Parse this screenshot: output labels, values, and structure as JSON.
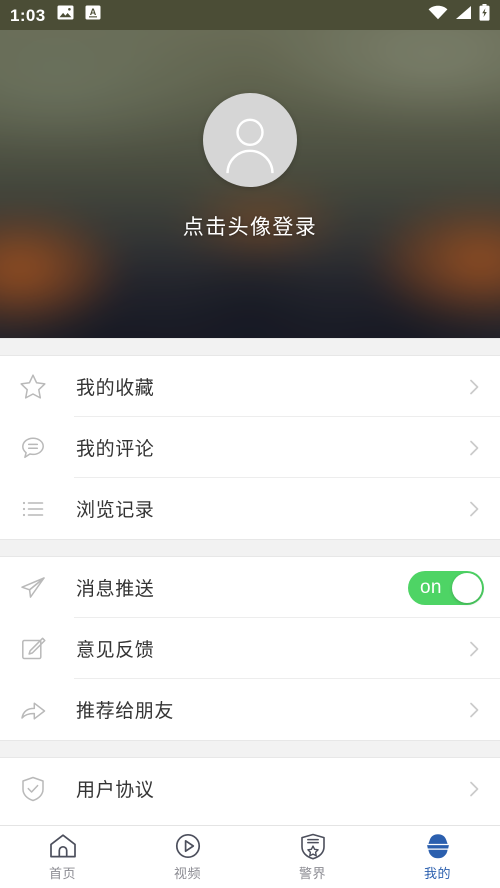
{
  "status_bar": {
    "time": "1:03",
    "left_icons": [
      "image-icon",
      "font-a-icon"
    ],
    "right_icons": [
      "wifi-icon",
      "signal-icon",
      "battery-charging-icon"
    ],
    "background_color": "#4b4d36"
  },
  "header": {
    "avatar_icon": "person-placeholder-icon",
    "login_prompt": "点击头像登录"
  },
  "sections": [
    {
      "items": [
        {
          "icon": "star-icon",
          "label": "我的收藏",
          "accessory": "chevron"
        },
        {
          "icon": "comment-icon",
          "label": "我的评论",
          "accessory": "chevron"
        },
        {
          "icon": "list-icon",
          "label": "浏览记录",
          "accessory": "chevron"
        }
      ]
    },
    {
      "items": [
        {
          "icon": "paper-plane-icon",
          "label": "消息推送",
          "accessory": "toggle",
          "toggle_label": "on",
          "toggle_on": true
        },
        {
          "icon": "edit-icon",
          "label": "意见反馈",
          "accessory": "chevron"
        },
        {
          "icon": "share-icon",
          "label": "推荐给朋友",
          "accessory": "chevron"
        }
      ]
    },
    {
      "items": [
        {
          "icon": "shield-check-icon",
          "label": "用户协议",
          "accessory": "chevron"
        }
      ]
    }
  ],
  "tabbar": {
    "active_color": "#2b5fae",
    "inactive_color": "#8b8b92",
    "tabs": [
      {
        "icon": "home-icon",
        "label": "首页",
        "active": false
      },
      {
        "icon": "video-play-icon",
        "label": "视频",
        "active": false
      },
      {
        "icon": "shield-star-icon",
        "label": "警界",
        "active": false
      },
      {
        "icon": "police-cap-icon",
        "label": "我的",
        "active": true
      }
    ]
  },
  "colors": {
    "toggle_on": "#4ed465",
    "text_primary": "#343434",
    "separator": "#ededed",
    "page_background": "#f2f2f2"
  }
}
